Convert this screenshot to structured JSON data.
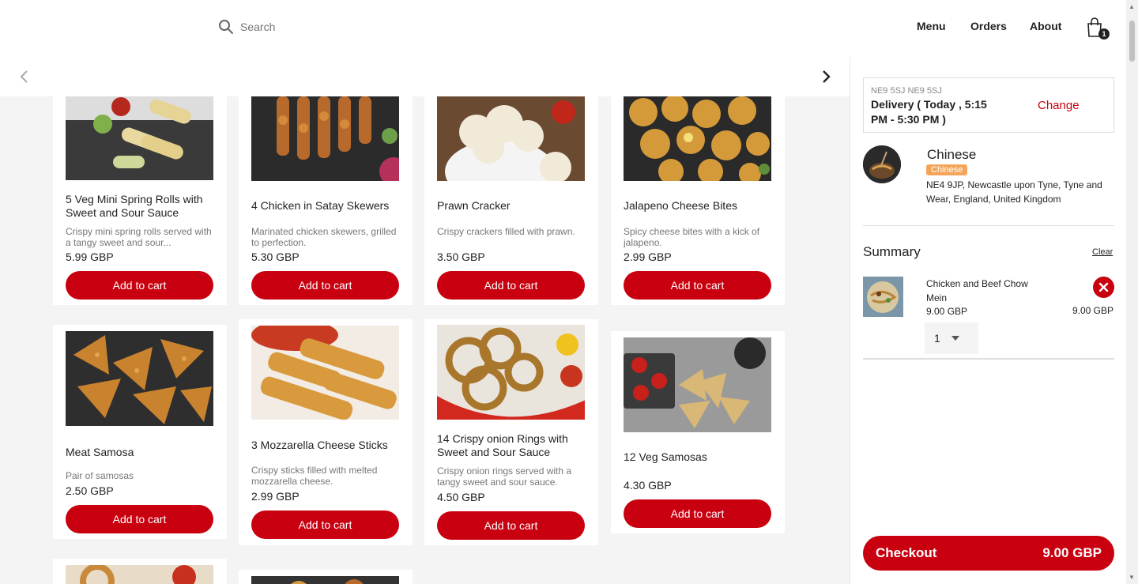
{
  "header": {
    "search_placeholder": "Search",
    "nav": [
      "Menu",
      "Orders",
      "About"
    ],
    "cart_count": "1"
  },
  "products": [
    {
      "name": "5 Veg Mini Spring Rolls with Sweet and Sour Sauce",
      "desc": "Crispy mini spring rolls served with a tangy sweet and sour...",
      "price": "5.99 GBP",
      "button": "Add to cart"
    },
    {
      "name": "4 Chicken in Satay Skewers",
      "desc": "Marinated chicken skewers, grilled to perfection.",
      "price": "5.30 GBP",
      "button": "Add to cart"
    },
    {
      "name": "Prawn Cracker",
      "desc": "Crispy crackers filled with prawn.",
      "price": "3.50 GBP",
      "button": "Add to cart"
    },
    {
      "name": "Jalapeno Cheese Bites",
      "desc": "Spicy cheese bites with a kick of jalapeno.",
      "price": "2.99 GBP",
      "button": "Add to cart"
    },
    {
      "name": "Meat Samosa",
      "desc": "Pair of samosas",
      "price": "2.50 GBP",
      "button": "Add to cart"
    },
    {
      "name": "3 Mozzarella Cheese Sticks",
      "desc": "Crispy sticks filled with melted mozzarella cheese.",
      "price": "2.99 GBP",
      "button": "Add to cart"
    },
    {
      "name": "14 Crispy onion Rings with Sweet and Sour Sauce",
      "desc": "Crispy onion rings served with a tangy sweet and sour sauce.",
      "price": "4.50 GBP",
      "button": "Add to cart"
    },
    {
      "name": "12 Veg Samosas",
      "desc": "",
      "price": "4.30 GBP",
      "button": "Add to cart"
    }
  ],
  "panel": {
    "postcode": "NE9 5SJ NE9 5SJ",
    "delivery": "Delivery ( Today , 5:15 PM - 5:30 PM )",
    "change": "Change",
    "restaurant_name": "Chinese",
    "restaurant_tag": "Chinese",
    "restaurant_address": "NE4 9JP, Newcastle upon Tyne, Tyne and Wear, England, United Kingdom",
    "summary_title": "Summary",
    "clear": "Clear",
    "item": {
      "name": "Chicken and Beef Chow Mein",
      "price": "9.00 GBP",
      "total": "9.00 GBP",
      "qty": "1"
    },
    "checkout_label": "Checkout",
    "checkout_total": "9.00 GBP"
  },
  "colors": {
    "accent": "#c8000f",
    "tag": "#f5a55a",
    "background": "#f4f4f4"
  }
}
